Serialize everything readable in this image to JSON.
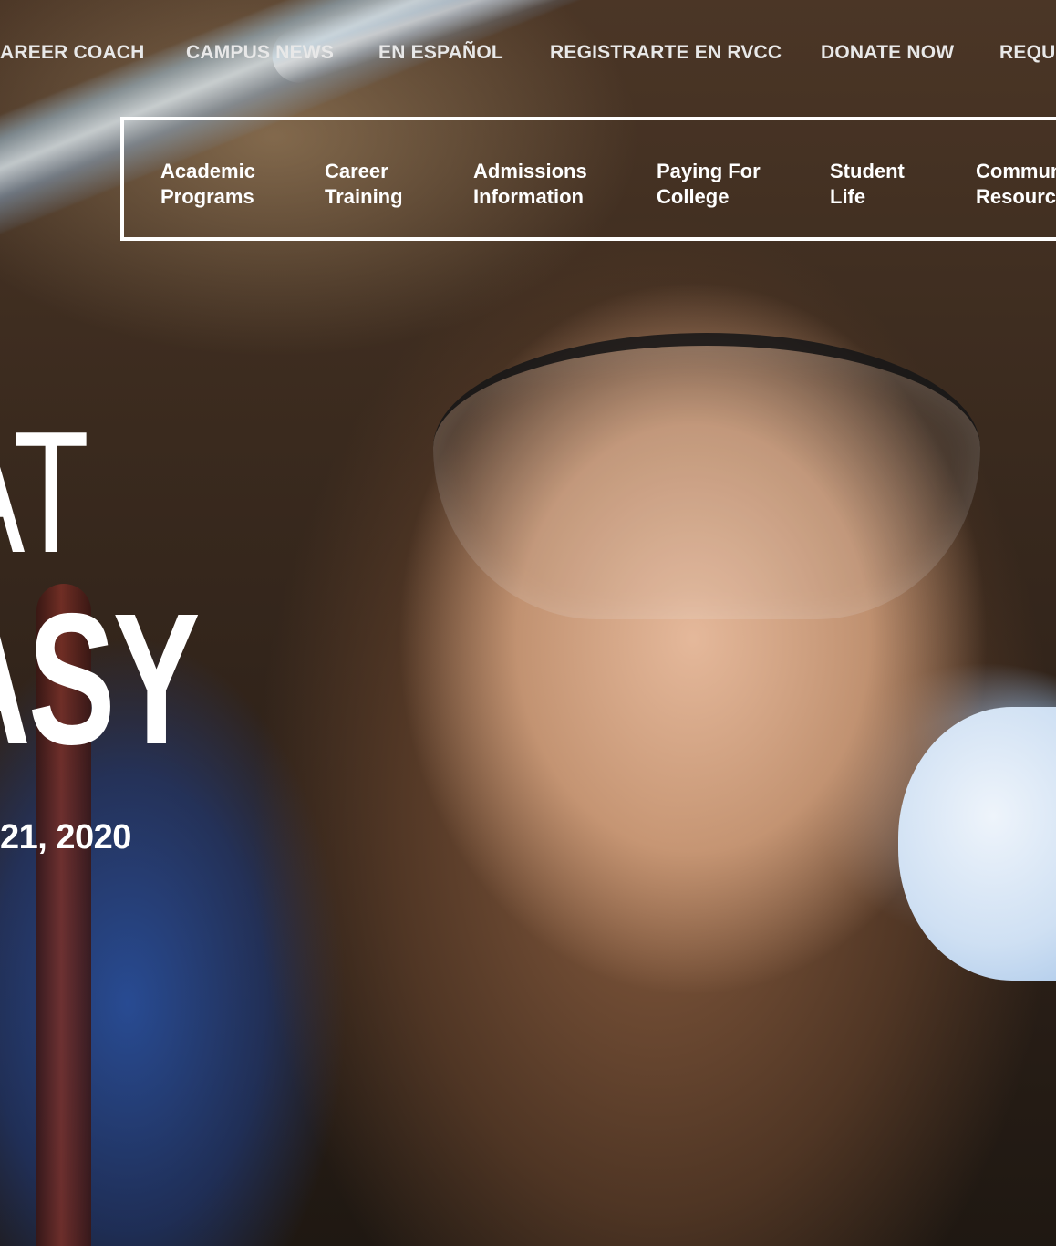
{
  "utility_nav": {
    "items": [
      {
        "label": "AREER COACH"
      },
      {
        "label": "CAMPUS NEWS"
      },
      {
        "label": "EN ESPAÑOL"
      },
      {
        "label": "REGISTRARTE EN RVCC"
      },
      {
        "label": "DONATE NOW"
      },
      {
        "label": "REQU"
      }
    ]
  },
  "main_nav": {
    "items": [
      {
        "label": "Academic\nPrograms"
      },
      {
        "label": "Career\nTraining"
      },
      {
        "label": "Admissions\nInformation"
      },
      {
        "label": "Paying For\nCollege"
      },
      {
        "label": "Student\nLife"
      },
      {
        "label": "Commun\nResourc"
      }
    ]
  },
  "hero": {
    "line1": "AT",
    "line2": "ASY",
    "date": "21, 2020",
    "photo_description_icon": "hero-photo"
  },
  "colors": {
    "nav_text": "#e8e8e8",
    "main_nav_border": "#ffffff",
    "headline": "#ffffff"
  }
}
